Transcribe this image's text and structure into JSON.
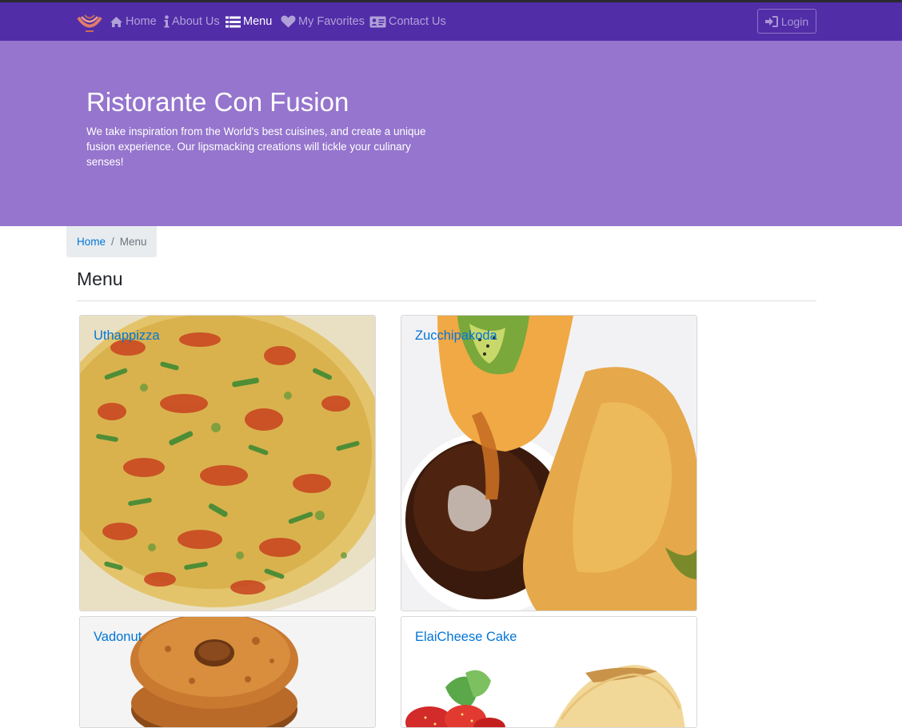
{
  "nav": {
    "items": [
      {
        "label": "Home",
        "icon": "home-icon"
      },
      {
        "label": "About Us",
        "icon": "info-icon"
      },
      {
        "label": "Menu",
        "icon": "list-icon",
        "active": true
      },
      {
        "label": "My Favorites",
        "icon": "heart-icon"
      },
      {
        "label": "Contact Us",
        "icon": "address-card-icon"
      }
    ],
    "login_label": "Login",
    "login_icon": "sign-in-icon",
    "logo_icon": "restaurant-logo-icon",
    "color": "#512da8",
    "active_color": "#ffffff"
  },
  "jumbotron": {
    "title": "Ristorante Con Fusion",
    "text": "We take inspiration from the World's best cuisines, and create a unique fusion experience. Our lipsmacking creations will tickle your culinary senses!",
    "color": "#9575cd"
  },
  "breadcrumb": {
    "home": "Home",
    "separator": "/",
    "current": "Menu"
  },
  "page": {
    "heading": "Menu"
  },
  "dishes": [
    {
      "name": "Uthappizza"
    },
    {
      "name": "Zucchipakoda"
    },
    {
      "name": "Vadonut"
    },
    {
      "name": "ElaiCheese Cake"
    }
  ],
  "link_color": "#0275d8"
}
